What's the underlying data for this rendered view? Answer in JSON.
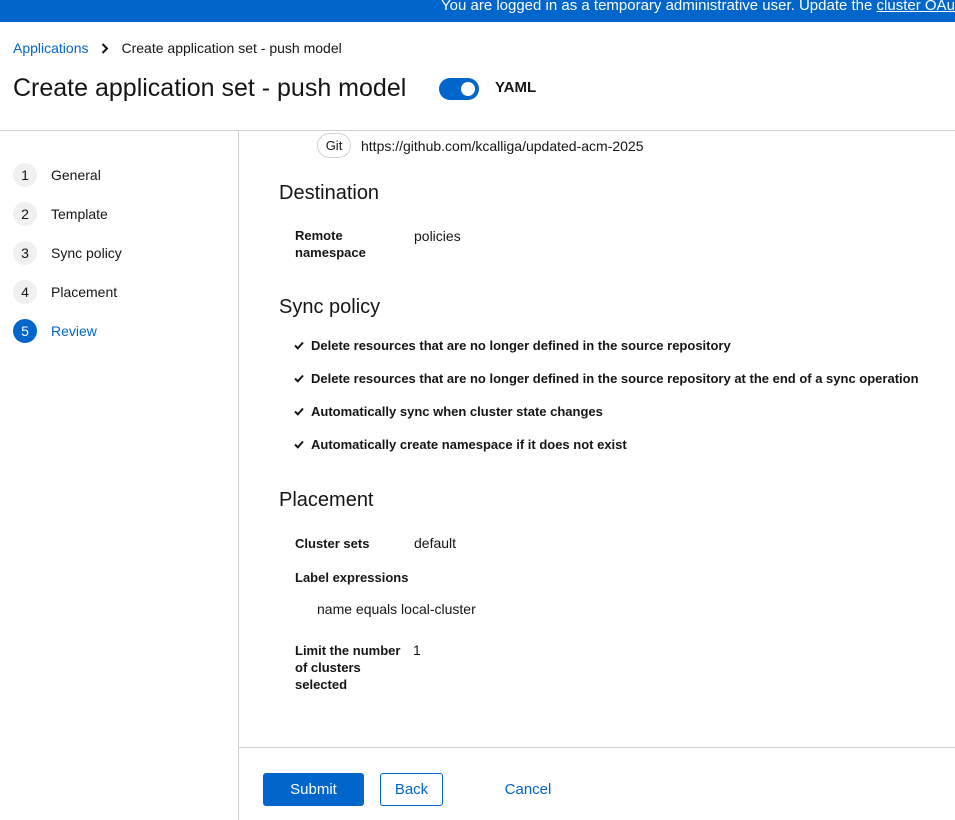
{
  "banner": {
    "text": "You are logged in as a temporary administrative user. Update the ",
    "link": "cluster OAuth con"
  },
  "breadcrumb": {
    "parent": "Applications",
    "current": "Create application set - push model"
  },
  "header": {
    "title": "Create application set - push model",
    "toggle_label": "YAML",
    "toggle_on": true
  },
  "nav": {
    "items": [
      {
        "num": "1",
        "label": "General"
      },
      {
        "num": "2",
        "label": "Template"
      },
      {
        "num": "3",
        "label": "Sync policy"
      },
      {
        "num": "4",
        "label": "Placement"
      },
      {
        "num": "5",
        "label": "Review"
      }
    ],
    "active_index": 4
  },
  "review": {
    "repo_type": "Git",
    "repo_url": "https://github.com/kcalliga/updated-acm-2025",
    "destination": {
      "title": "Destination",
      "term1": "Remote",
      "term2": "namespace",
      "value": "policies"
    },
    "sync_policy": {
      "title": "Sync policy",
      "items": [
        "Delete resources that are no longer defined in the source repository",
        "Delete resources that are no longer defined in the source repository at the end of a sync operation",
        "Automatically sync when cluster state changes",
        "Automatically create namespace if it does not exist"
      ]
    },
    "placement": {
      "title": "Placement",
      "cluster_sets_term": "Cluster sets",
      "cluster_sets_value": "default",
      "label_expr_term": "Label expressions",
      "label_expr_value": "name equals local-cluster",
      "limit_term1": "Limit the number",
      "limit_term2": "of clusters",
      "limit_term3": "selected",
      "limit_value": "1"
    }
  },
  "footer": {
    "submit": "Submit",
    "back": "Back",
    "cancel": "Cancel"
  },
  "colors": {
    "primary": "#0066cc",
    "text": "#151515",
    "border": "#d2d2d2"
  }
}
